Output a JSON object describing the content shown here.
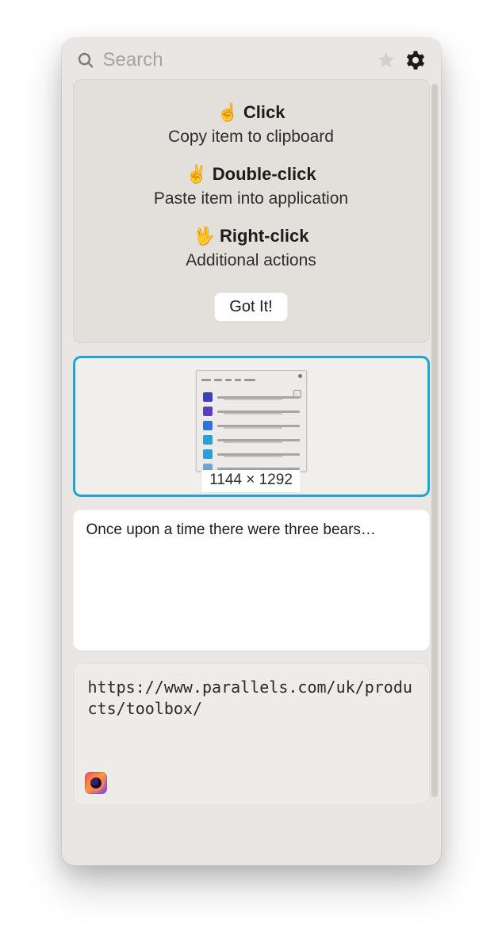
{
  "search": {
    "placeholder": "Search"
  },
  "help": {
    "click": {
      "emoji": "☝️",
      "title": "Click",
      "sub": "Copy item to clipboard"
    },
    "double_click": {
      "emoji": "✌️",
      "title": "Double-click",
      "sub": "Paste item into application"
    },
    "right_click": {
      "emoji": "🖖",
      "title": "Right-click",
      "sub": "Additional actions"
    },
    "confirm_label": "Got It!"
  },
  "items": {
    "screenshot": {
      "dimensions": "1144 × 1292"
    },
    "text": {
      "content": "Once upon a time there were three bears…"
    },
    "url": {
      "content": "https://www.parallels.com/uk/products/toolbox/",
      "source_app": "firefox"
    }
  }
}
